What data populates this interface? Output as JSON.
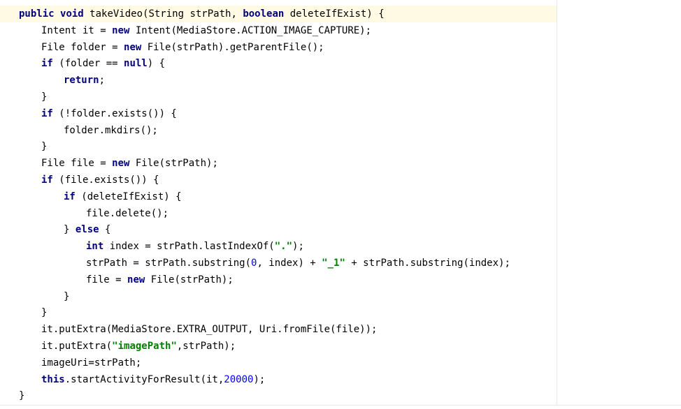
{
  "editor": {
    "lines": [
      {
        "indent": 0,
        "tokens": [
          {
            "t": "public",
            "k": "kw"
          },
          {
            "t": " "
          },
          {
            "t": "void",
            "k": "kw"
          },
          {
            "t": " takeVideo(String strPath, "
          },
          {
            "t": "boolean",
            "k": "kw"
          },
          {
            "t": " deleteIfExist) {"
          }
        ]
      },
      {
        "indent": 1,
        "tokens": [
          {
            "t": "Intent it = "
          },
          {
            "t": "new",
            "k": "kw"
          },
          {
            "t": " Intent(MediaStore.ACTION_IMAGE_CAPTURE);"
          }
        ]
      },
      {
        "indent": 1,
        "tokens": [
          {
            "t": "File folder = "
          },
          {
            "t": "new",
            "k": "kw"
          },
          {
            "t": " File(strPath).getParentFile();"
          }
        ]
      },
      {
        "indent": 1,
        "tokens": [
          {
            "t": "if",
            "k": "kw"
          },
          {
            "t": " (folder == "
          },
          {
            "t": "null",
            "k": "kw"
          },
          {
            "t": ") {"
          }
        ]
      },
      {
        "indent": 2,
        "tokens": [
          {
            "t": "return",
            "k": "kw"
          },
          {
            "t": ";"
          }
        ]
      },
      {
        "indent": 1,
        "tokens": [
          {
            "t": "}"
          }
        ]
      },
      {
        "indent": 1,
        "tokens": [
          {
            "t": "if",
            "k": "kw"
          },
          {
            "t": " (!folder.exists()) {"
          }
        ]
      },
      {
        "indent": 2,
        "tokens": [
          {
            "t": "folder.mkdirs();"
          }
        ]
      },
      {
        "indent": 1,
        "tokens": [
          {
            "t": "}"
          }
        ]
      },
      {
        "indent": 1,
        "tokens": [
          {
            "t": "File file = "
          },
          {
            "t": "new",
            "k": "kw"
          },
          {
            "t": " File(strPath);"
          }
        ]
      },
      {
        "indent": 1,
        "tokens": [
          {
            "t": "if",
            "k": "kw"
          },
          {
            "t": " (file.exists()) {"
          }
        ]
      },
      {
        "indent": 2,
        "tokens": [
          {
            "t": "if",
            "k": "kw"
          },
          {
            "t": " (deleteIfExist) {"
          }
        ]
      },
      {
        "indent": 3,
        "tokens": [
          {
            "t": "file.delete();"
          }
        ]
      },
      {
        "indent": 2,
        "tokens": [
          {
            "t": "} "
          },
          {
            "t": "else",
            "k": "kw"
          },
          {
            "t": " {"
          }
        ]
      },
      {
        "indent": 3,
        "tokens": [
          {
            "t": "int",
            "k": "kw"
          },
          {
            "t": " index = strPath.lastIndexOf("
          },
          {
            "t": "\".\"",
            "k": "str"
          },
          {
            "t": ");"
          }
        ]
      },
      {
        "indent": 3,
        "tokens": [
          {
            "t": "strPath = strPath.substring("
          },
          {
            "t": "0",
            "k": "num"
          },
          {
            "t": ", index) + "
          },
          {
            "t": "\"_1\"",
            "k": "str"
          },
          {
            "t": " + strPath.substring(index);"
          }
        ]
      },
      {
        "indent": 3,
        "tokens": [
          {
            "t": "file = "
          },
          {
            "t": "new",
            "k": "kw"
          },
          {
            "t": " File(strPath);"
          }
        ]
      },
      {
        "indent": 2,
        "tokens": [
          {
            "t": "}"
          }
        ]
      },
      {
        "indent": 1,
        "tokens": [
          {
            "t": "}"
          }
        ]
      },
      {
        "indent": 1,
        "tokens": [
          {
            "t": "it.putExtra(MediaStore.EXTRA_OUTPUT, Uri.fromFile(file));"
          }
        ]
      },
      {
        "indent": 1,
        "tokens": [
          {
            "t": "it.putExtra("
          },
          {
            "t": "\"imagePath\"",
            "k": "str"
          },
          {
            "t": ",strPath);"
          }
        ]
      },
      {
        "indent": 1,
        "tokens": [
          {
            "t": "imageUri=strPath;"
          }
        ]
      },
      {
        "indent": 1,
        "tokens": [
          {
            "t": "this",
            "k": "kw"
          },
          {
            "t": ".startActivityForResult(it,"
          },
          {
            "t": "20000",
            "k": "num"
          },
          {
            "t": ");"
          }
        ]
      },
      {
        "indent": 0,
        "tokens": [
          {
            "t": "}"
          }
        ]
      }
    ]
  },
  "colors": {
    "keyword": "#000080",
    "string": "#008000",
    "number": "#0000ff",
    "current_line": "#fffae3",
    "margin_line": "#e8e8e8"
  }
}
